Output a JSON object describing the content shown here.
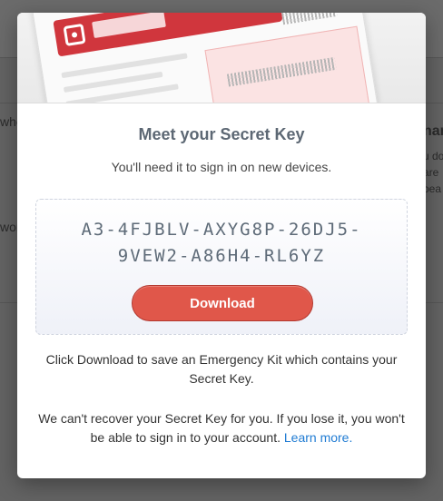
{
  "background": {
    "left_fragments": [
      "whe",
      "word"
    ],
    "right_fragments": [
      "nar",
      "u do",
      "are",
      "pea"
    ]
  },
  "modal": {
    "title": "Meet your Secret Key",
    "subtitle": "You'll need it to sign in on new devices.",
    "secret_key": {
      "line1": "A3-4FJBLV-AXYG8P-26DJ5-",
      "line2": "9VEW2-A86H4-RL6YZ"
    },
    "download_label": "Download",
    "info_text": "Click Download to save an Emergency Kit which contains your Secret Key.",
    "warning_text": "We can't recover your Secret Key for you. If you lose it, you won't be able to sign in to your account.",
    "learn_more_label": "Learn more."
  },
  "colors": {
    "download_button": "#e0574a",
    "link": "#1f7bd3",
    "kit_banner": "#d0363d"
  },
  "icons": {
    "kit_logo": "emergency-kit-logo-icon"
  }
}
